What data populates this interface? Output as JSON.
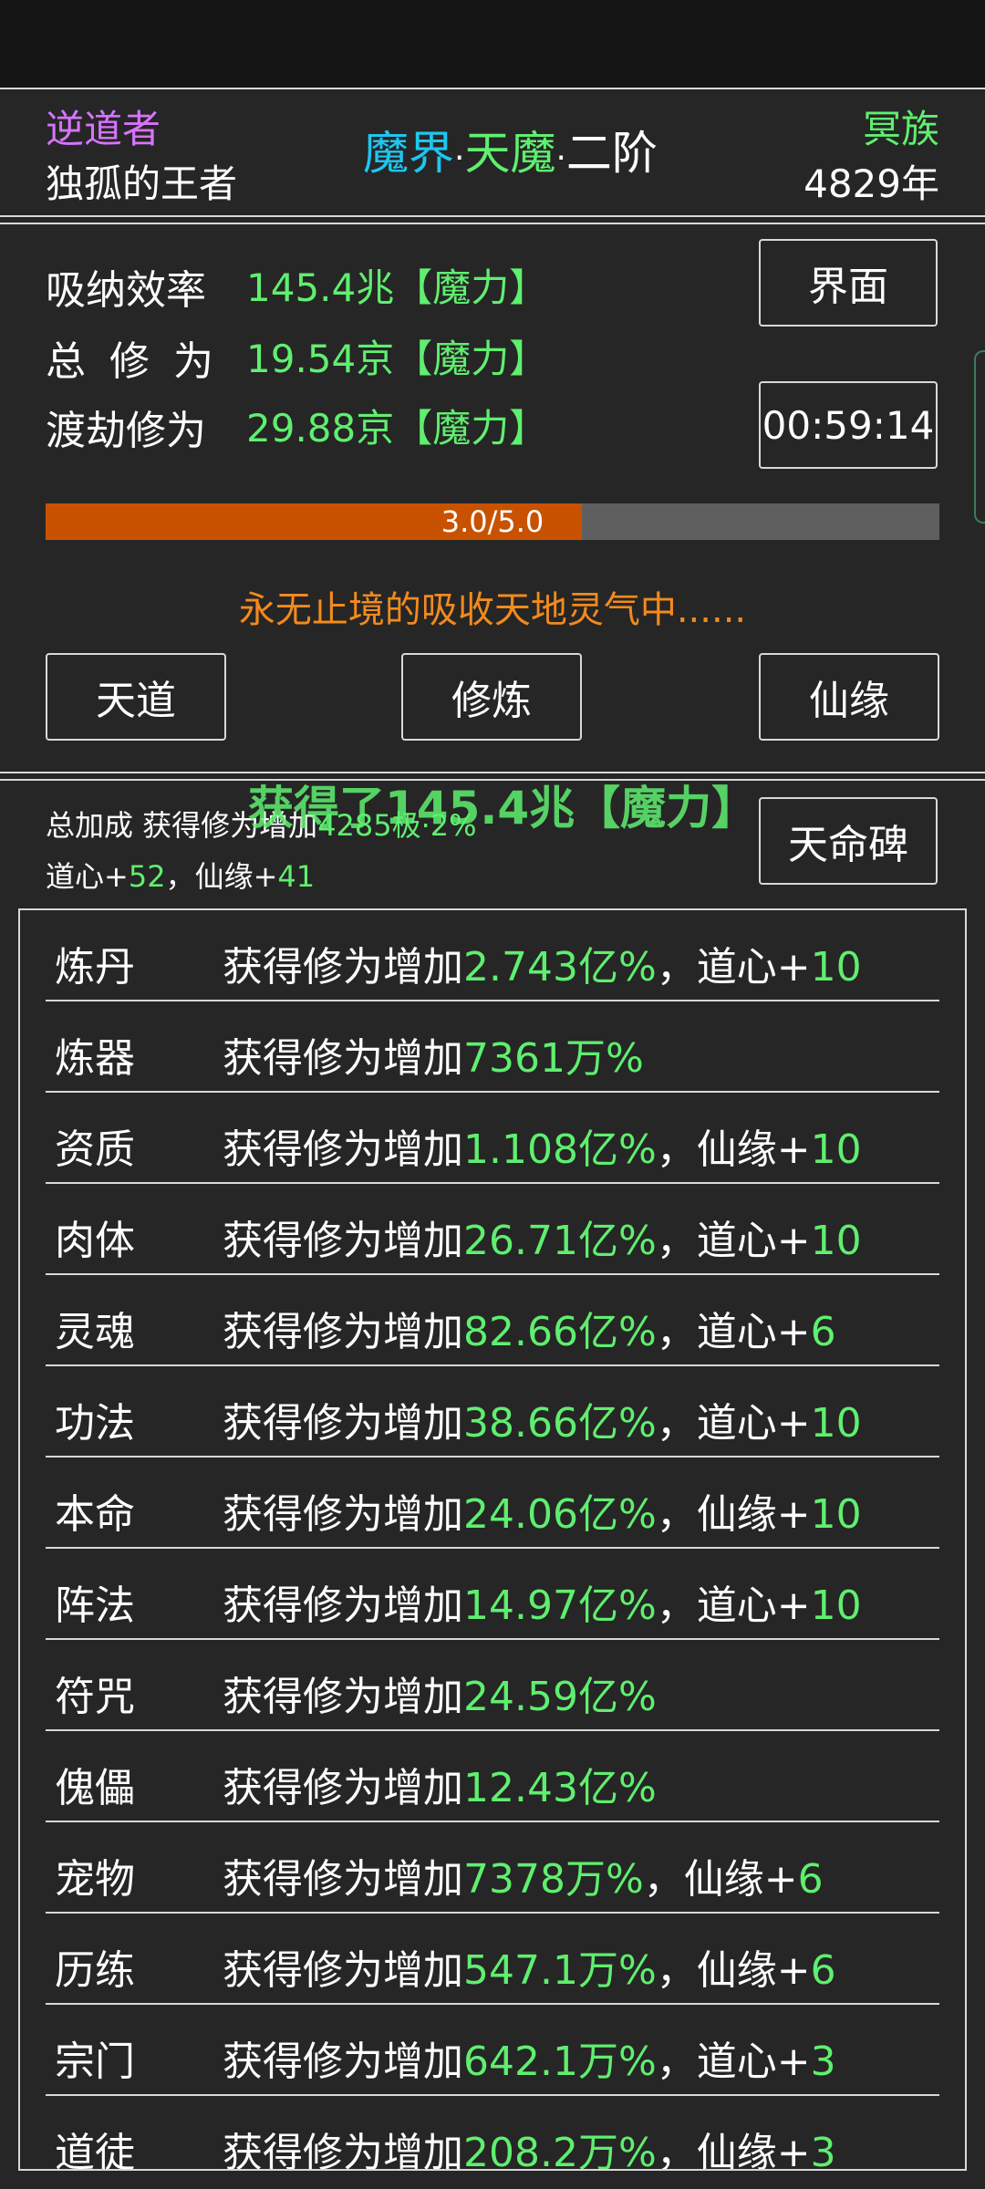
{
  "header": {
    "faction_left": "逆道者",
    "title_left": "独孤的王者",
    "realm_part1": "魔界",
    "realm_part2": "天魔",
    "realm_part3": "二阶",
    "dot": "·",
    "race": "冥族",
    "age": "4829年"
  },
  "stats": {
    "absorb_label": "吸纳效率",
    "absorb_value": "145.4兆【魔力】",
    "total_label": "总 修 为",
    "total_value": "19.54京【魔力】",
    "tribulation_label": "渡劫修为",
    "tribulation_value": "29.88京【魔力】",
    "interface_button": "界面",
    "timer": "00:59:14",
    "progress_text": "3.0/5.0",
    "progress_fraction": 0.6,
    "status_text": "永无止境的吸收天地灵气中......",
    "btn_tiandao": "天道",
    "btn_xiulian": "修炼",
    "btn_xianyuan": "仙缘"
  },
  "bonus": {
    "float_text": "获得了145.4兆【魔力】",
    "total_prefix": "总加成 获得修为增加",
    "total_value": "4285极·2%",
    "daoxin_label": "道心+",
    "daoxin_value": "52",
    "sep": "，",
    "xianyuan_label": "仙缘+",
    "xianyuan_value": "41",
    "stele_button": "天命碑"
  },
  "rows": [
    {
      "name": "炼丹",
      "prefix": "获得修为增加",
      "value": "2.743亿%",
      "extra_label": "，道心+",
      "extra_value": "10"
    },
    {
      "name": "炼器",
      "prefix": "获得修为增加",
      "value": "7361万%",
      "extra_label": "",
      "extra_value": ""
    },
    {
      "name": "资质",
      "prefix": "获得修为增加",
      "value": "1.108亿%",
      "extra_label": "，仙缘+",
      "extra_value": "10"
    },
    {
      "name": "肉体",
      "prefix": "获得修为增加",
      "value": "26.71亿%",
      "extra_label": "，道心+",
      "extra_value": "10"
    },
    {
      "name": "灵魂",
      "prefix": "获得修为增加",
      "value": "82.66亿%",
      "extra_label": "，道心+",
      "extra_value": "6"
    },
    {
      "name": "功法",
      "prefix": "获得修为增加",
      "value": "38.66亿%",
      "extra_label": "，道心+",
      "extra_value": "10"
    },
    {
      "name": "本命",
      "prefix": "获得修为增加",
      "value": "24.06亿%",
      "extra_label": "，仙缘+",
      "extra_value": "10"
    },
    {
      "name": "阵法",
      "prefix": "获得修为增加",
      "value": "14.97亿%",
      "extra_label": "，道心+",
      "extra_value": "10"
    },
    {
      "name": "符咒",
      "prefix": "获得修为增加",
      "value": "24.59亿%",
      "extra_label": "",
      "extra_value": ""
    },
    {
      "name": "傀儡",
      "prefix": "获得修为增加",
      "value": "12.43亿%",
      "extra_label": "",
      "extra_value": ""
    },
    {
      "name": "宠物",
      "prefix": "获得修为增加",
      "value": "7378万%",
      "extra_label": "，仙缘+",
      "extra_value": "6"
    },
    {
      "name": "历练",
      "prefix": "获得修为增加",
      "value": "547.1万%",
      "extra_label": "，仙缘+",
      "extra_value": "6"
    },
    {
      "name": "宗门",
      "prefix": "获得修为增加",
      "value": "642.1万%",
      "extra_label": "，道心+",
      "extra_value": "3"
    },
    {
      "name": "道徒",
      "prefix": "获得修为增加",
      "value": "208.2万%",
      "extra_label": "，仙缘+",
      "extra_value": "3"
    }
  ],
  "colors": {
    "purple": "#d873ff",
    "cyan": "#1ec6f0",
    "green": "#5fef6f",
    "orange": "#f28a1e",
    "progress_fill": "#c85200",
    "progress_track": "#5f5f5f"
  }
}
